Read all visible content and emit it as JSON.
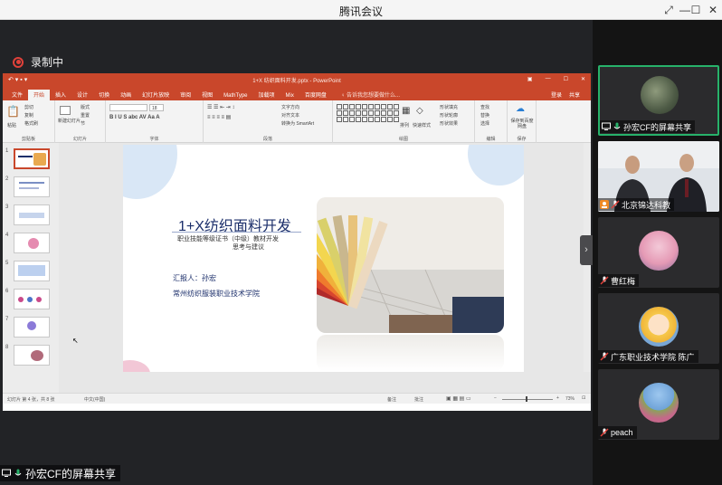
{
  "app": {
    "title": "腾讯会议"
  },
  "window_controls": {
    "restore": "⤢",
    "minimize": "—",
    "maximize": "☐",
    "close": "✕"
  },
  "recording": {
    "label": "录制中"
  },
  "screen_share": {
    "label": "孙宏CF的屏幕共享"
  },
  "powerpoint": {
    "doc_title": "1+X 纺织面料开发.pptx - PowerPoint",
    "tabs": [
      "文件",
      "开始",
      "插入",
      "设计",
      "切换",
      "动画",
      "幻灯片放映",
      "审阅",
      "视图",
      "MathType",
      "加载项",
      "Mix",
      "百度网盘"
    ],
    "tell_me": "♀ 告诉我您想要做什么...",
    "login": "登录",
    "share": "共享",
    "ribbon": {
      "paste": "粘贴",
      "cut": "剪切",
      "copy": "复制",
      "format_painter": "格式刷",
      "clipboard": "剪贴板",
      "new_slide": "新建幻灯片",
      "layout": "版式",
      "reset": "重置",
      "section": "节",
      "slides": "幻灯片",
      "font_group": "字体",
      "font_size": "18",
      "text_direction": "文字方向",
      "align_text": "对齐文本",
      "smartart": "转换为 SmartArt",
      "paragraph": "段落",
      "arrange": "排列",
      "quick_styles": "快速样式",
      "shape_fill": "形状填充",
      "shape_outline": "形状轮廓",
      "shape_effects": "形状效果",
      "drawing": "绘图",
      "find": "查找",
      "replace": "替换",
      "select": "选择",
      "editing": "编辑",
      "save_baidu": "保存到百度网盘",
      "save_group": "保存"
    },
    "thumbnails": [
      "1",
      "2",
      "3",
      "4",
      "5",
      "6",
      "7",
      "8"
    ],
    "slide": {
      "title": "1+X纺织面料开发",
      "subtitle_1": "职业技能等级证书（中级）教材开发",
      "subtitle_2": "思考与建议",
      "reporter": "汇报人：孙宏",
      "school": "常州纺织服装职业技术学院"
    },
    "status": {
      "slide_info": "幻灯片 第 4 张，共 8 张",
      "language": "中文(中国)",
      "notes": "备注",
      "comments": "批注",
      "zoom": "73%"
    }
  },
  "participants": [
    {
      "name": "孙宏CF的屏幕共享",
      "icon": "screen-share-icon",
      "active": true
    },
    {
      "name": "北京锦达科教",
      "icon": "host-icon",
      "active": false
    },
    {
      "name": "曹红梅",
      "icon": "mic-muted-icon",
      "active": false
    },
    {
      "name": "广东职业技术学院 陈广",
      "icon": "mic-muted-icon",
      "active": false
    },
    {
      "name": "peach",
      "icon": "mic-muted-icon",
      "active": false
    }
  ],
  "colors": {
    "ppt_red": "#c9472b",
    "rec_red": "#e0413a",
    "active_green": "#27b26a",
    "slide_title": "#1c2f6b"
  }
}
